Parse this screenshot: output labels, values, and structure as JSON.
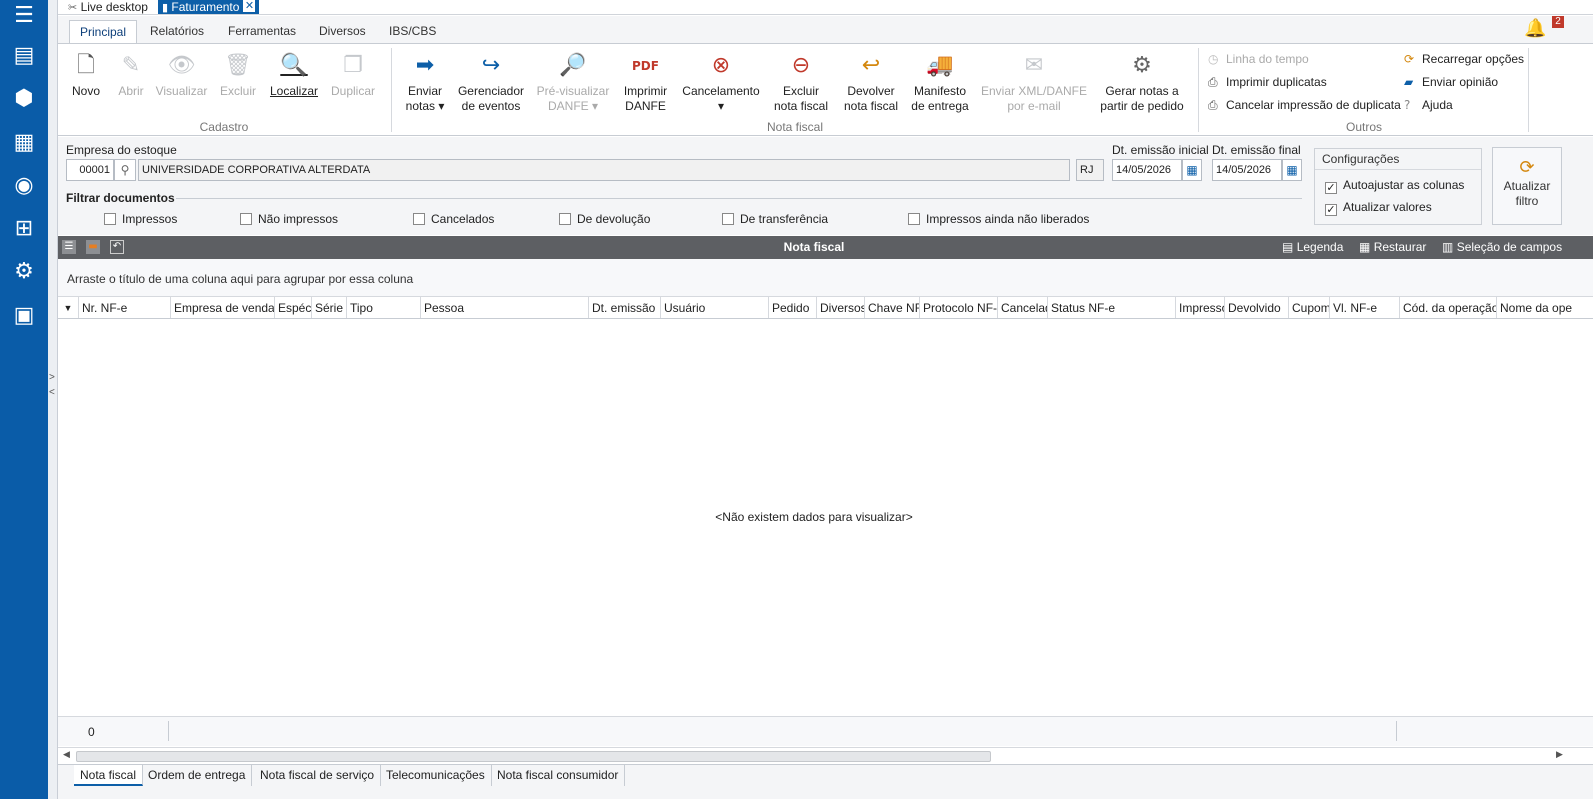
{
  "sidebar": {
    "icons": [
      "menu-icon",
      "contacts-icon",
      "boxes-icon",
      "invoice-icon",
      "coins-icon",
      "hierarchy-icon",
      "settings-icon",
      "apps-icon"
    ]
  },
  "topbar": {
    "tab1": "Live desktop",
    "tab2": "Faturamento",
    "close": "✕",
    "notif_count": "2"
  },
  "ribbon_tabs": [
    "Principal",
    "Relatórios",
    "Ferramentas",
    "Diversos",
    "IBS/CBS"
  ],
  "ribbon": {
    "cadastro": {
      "label": "Cadastro",
      "buttons": [
        "Novo",
        "Abrir",
        "Visualizar",
        "Excluir",
        "Localizar",
        "Duplicar"
      ]
    },
    "nota_fiscal": {
      "label": "Nota fiscal",
      "enviar": [
        "Enviar",
        "notas ▾"
      ],
      "gerenciador": [
        "Gerenciador",
        "de eventos"
      ],
      "previsualizar": [
        "Pré-visualizar",
        "DANFE ▾"
      ],
      "imprimir": [
        "Imprimir",
        "DANFE"
      ],
      "cancelamento": [
        "Cancelamento",
        "▾"
      ],
      "excluir": [
        "Excluir",
        "nota fiscal"
      ],
      "devolver": [
        "Devolver",
        "nota fiscal"
      ],
      "manifesto": [
        "Manifesto",
        "de entrega"
      ],
      "enviar_xml": [
        "Enviar XML/DANFE",
        "por e-mail"
      ],
      "gerar": [
        "Gerar notas a",
        "partir de pedido"
      ]
    },
    "outros": {
      "label": "Outros",
      "linha_tempo": "Linha do tempo",
      "imprimir_dup": "Imprimir duplicatas",
      "cancelar_dup": "Cancelar impressão de duplicata",
      "recarregar": "Recarregar opções",
      "enviar_opiniao": "Enviar opinião",
      "ajuda": "Ajuda"
    }
  },
  "filter": {
    "empresa_label": "Empresa do estoque",
    "empresa_code": "00001",
    "empresa_name": "UNIVERSIDADE CORPORATIVA ALTERDATA",
    "uf": "RJ",
    "dt_inicial_label": "Dt. emissão inicial",
    "dt_inicial": "14/05/2026",
    "dt_final_label": "Dt. emissão final",
    "dt_final": "14/05/2026",
    "filtrar_label": "Filtrar documentos",
    "checks": [
      "Impressos",
      "Não impressos",
      "Cancelados",
      "De devolução",
      "De transferência",
      "Impressos ainda não liberados"
    ]
  },
  "config": {
    "title": "Configurações",
    "autoajustar": "Autoajustar as colunas",
    "atualizar_valores": "Atualizar valores",
    "atualizar_filtro": [
      "Atualizar",
      "filtro"
    ]
  },
  "grid": {
    "title": "Nota fiscal",
    "legenda": "Legenda",
    "restaurar": "Restaurar",
    "selecao": "Seleção de campos",
    "group_hint": "Arraste o título de uma coluna aqui para agrupar por essa coluna",
    "columns": [
      "Nr. NF-e",
      "Empresa de venda",
      "Espéci",
      "Série",
      "Tipo",
      "Pessoa",
      "Dt. emissão",
      "Usuário",
      "Pedido",
      "Diversos",
      "Chave NF",
      "Protocolo NF-",
      "Cancelad",
      "Status NF-e",
      "Impresso",
      "Devolvido",
      "Cupom",
      "Vl. NF-e",
      "Cód. da operação",
      "Nome da ope"
    ],
    "empty": "<Não existem dados para visualizar>",
    "count": "0"
  },
  "bottom_tabs": [
    "Nota fiscal",
    "Ordem de entrega",
    "Nota fiscal de serviço",
    "Telecomunicações",
    "Nota fiscal consumidor"
  ]
}
